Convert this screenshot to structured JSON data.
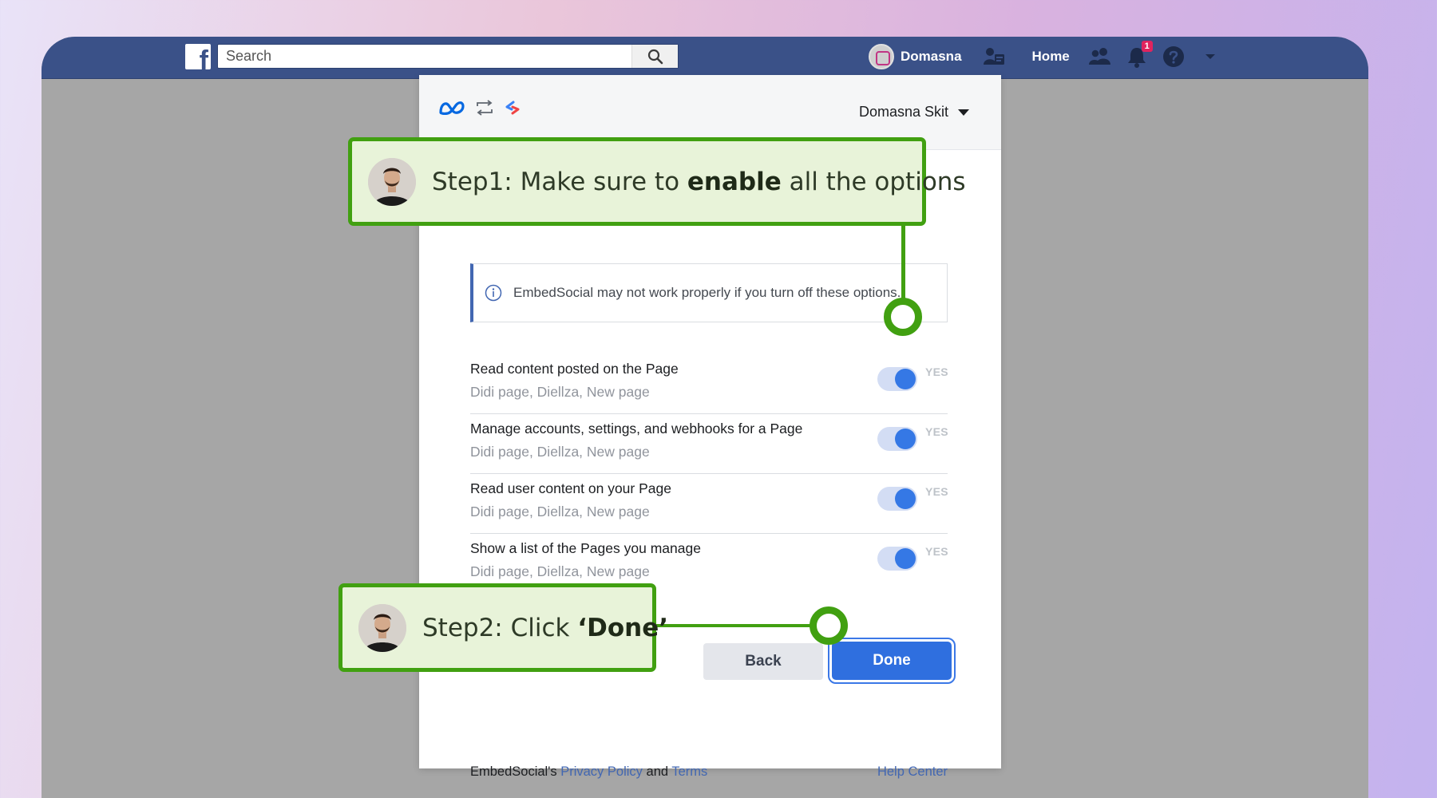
{
  "topbar": {
    "search_placeholder": "Search",
    "profile_name": "Domasna",
    "home_label": "Home",
    "notification_count": "1",
    "logo_letter": "f"
  },
  "dialog": {
    "account_name": "Domasna Skit",
    "info_text": "EmbedSocial may not work properly if you turn off these options.",
    "yes_label": "YES",
    "permissions": [
      {
        "title": "Read content posted on the Page",
        "pages": "Didi page, Diellza, New page",
        "enabled": true
      },
      {
        "title": "Manage accounts, settings, and webhooks for a Page",
        "pages": "Didi page, Diellza, New page",
        "enabled": true
      },
      {
        "title": "Read user content on your Page",
        "pages": "Didi page, Diellza, New page",
        "enabled": true
      },
      {
        "title": "Show a list of the Pages you manage",
        "pages": "Didi page, Diellza, New page",
        "enabled": true
      }
    ],
    "back_label": "Back",
    "done_label": "Done",
    "footer": {
      "prefix": "EmbedSocial's",
      "privacy_label": "Privacy Policy",
      "and_label": "and",
      "terms_label": "Terms",
      "help_label": "Help Center"
    }
  },
  "callouts": {
    "step1": {
      "prefix": "Step1: Make sure to ",
      "bold": "enable",
      "suffix": " all the options"
    },
    "step2": {
      "prefix": "Step2: Click ",
      "bold": "‘Done’"
    }
  },
  "colors": {
    "facebook_blue": "#3a5188",
    "toggle_blue": "#3578e5",
    "done_blue": "#2f6fdf",
    "callout_green": "#41a011",
    "callout_bg": "#e8f3d9"
  }
}
